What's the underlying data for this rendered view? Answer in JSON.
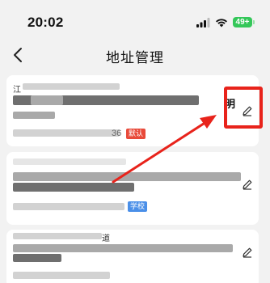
{
  "status_bar": {
    "time": "20:02",
    "battery": "49+",
    "signal_icon": "cellular-signal-icon",
    "wifi_icon": "wifi-icon",
    "battery_icon": "battery-icon"
  },
  "nav": {
    "title": "地址管理",
    "back_icon": "chevron-left-icon"
  },
  "addresses": [
    {
      "address_visible": "江",
      "name_visible": "明",
      "phone_visible": "36",
      "tag": "默认",
      "tag_color": "#e84a3a",
      "edit_icon": "pencil-icon"
    },
    {
      "tag": "学校",
      "tag_color": "#4a8fe8",
      "edit_icon": "pencil-icon"
    },
    {
      "address_visible": "道",
      "edit_icon": "pencil-icon"
    }
  ],
  "annotation": {
    "color": "#e8231b",
    "type": "highlight-box-with-arrow"
  }
}
